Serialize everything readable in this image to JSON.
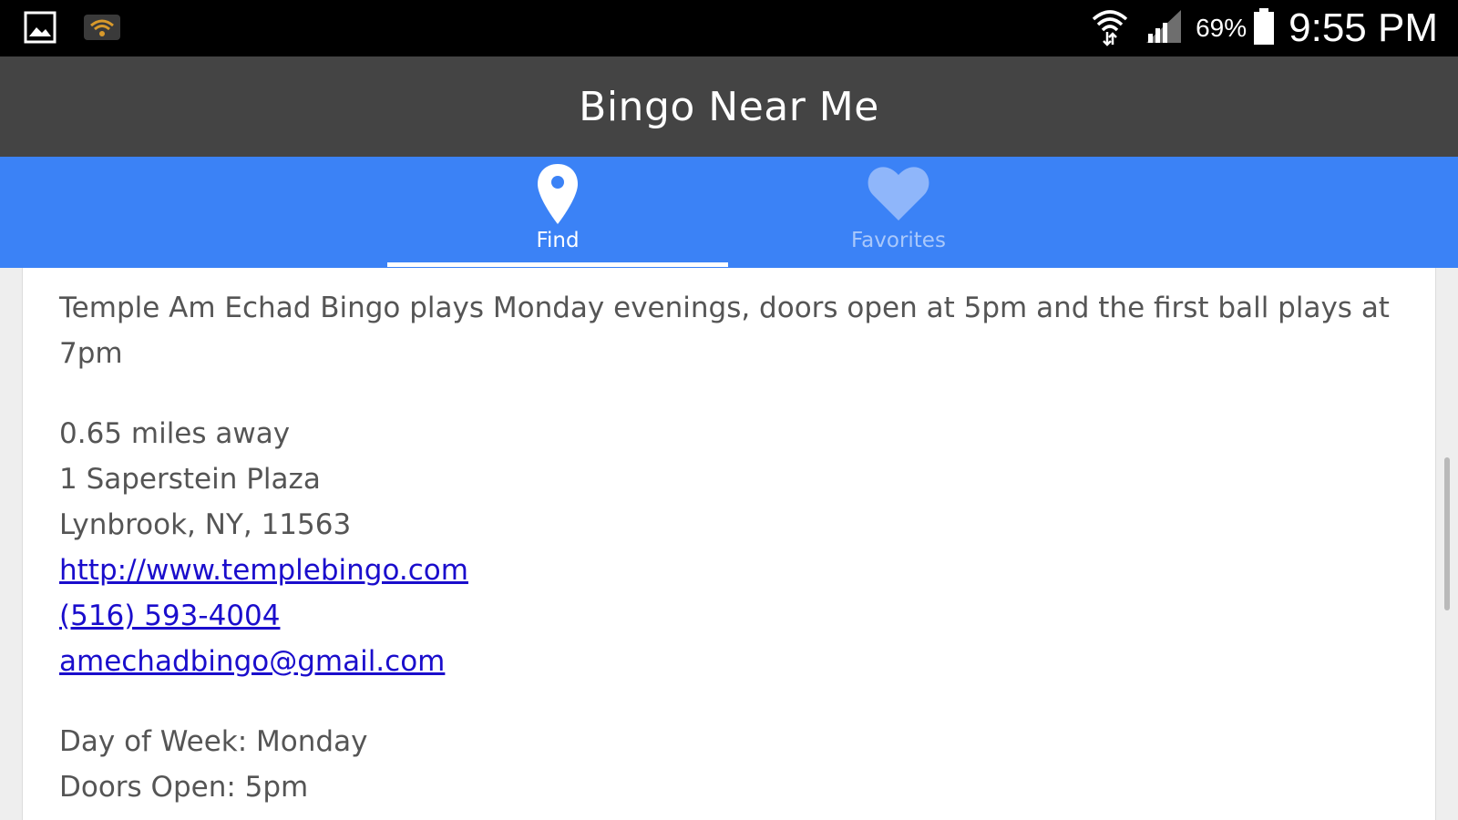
{
  "status_bar": {
    "battery_percent": "69%",
    "time": "9:55 PM",
    "left_icons": [
      "gallery-icon",
      "wifi-hotspot-icon"
    ],
    "right_icons": [
      "wifi-icon",
      "signal-icon",
      "battery-icon"
    ]
  },
  "app": {
    "title": "Bingo Near Me"
  },
  "tabs": [
    {
      "label": "Find",
      "icon": "location-pin-icon",
      "active": true
    },
    {
      "label": "Favorites",
      "icon": "heart-icon",
      "active": false
    }
  ],
  "colors": {
    "tab_bar": "#3b82f6",
    "title_bar": "#444444",
    "link": "#1a0dcc",
    "text": "#555555"
  },
  "listing": {
    "description": "Temple Am Echad Bingo plays Monday evenings, doors open at 5pm and the first ball plays at 7pm",
    "distance": "0.65 miles away",
    "address_line1": "1 Saperstein Plaza",
    "address_line2": "Lynbrook, NY, 11563",
    "website": "http://www.templebingo.com",
    "phone": "(516) 593-4004",
    "email": "amechadbingo@gmail.com",
    "day_of_week": "Day of Week: Monday",
    "doors_open": "Doors Open: 5pm"
  }
}
